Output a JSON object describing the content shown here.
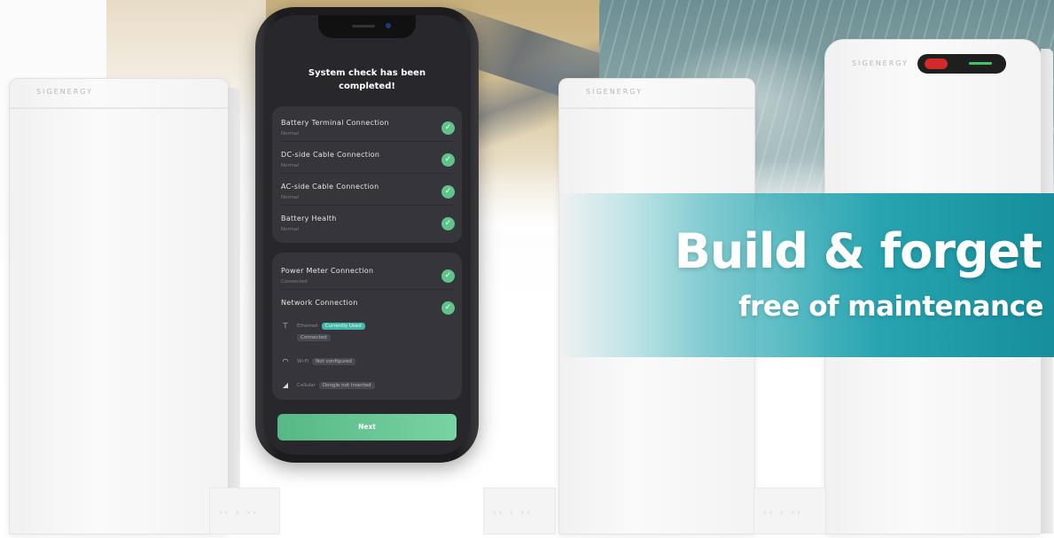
{
  "brand": {
    "name": "SIGENERGY"
  },
  "decor": {
    "chevrons": "‹‹ › ››"
  },
  "phone": {
    "title": "System check has been completed!",
    "group1": [
      {
        "label": "Battery Terminal Connection",
        "status": "Normal"
      },
      {
        "label": "DC-side Cable Connection",
        "status": "Normal"
      },
      {
        "label": "AC-side Cable Connection",
        "status": "Normal"
      },
      {
        "label": "Battery Health",
        "status": "Normal"
      }
    ],
    "group2": {
      "power_meter": {
        "label": "Power Meter Connection",
        "status": "Connected"
      },
      "network": {
        "label": "Network Connection"
      },
      "ethernet": {
        "label": "Ethernet",
        "tag": "Currently Used",
        "status": "Connected"
      },
      "wifi": {
        "label": "Wi-Fi",
        "status": "Not configured"
      },
      "cellular": {
        "label": "Cellular",
        "status": "Dongle not inserted"
      }
    },
    "next_label": "Next",
    "icons": {
      "check": "check-icon",
      "ethernet": "ethernet-icon",
      "wifi": "wifi-icon",
      "cellular": "cellular-icon"
    }
  },
  "banner": {
    "headline": "Build & forget",
    "subline": "free of maintenance"
  },
  "colors": {
    "accent": "#27a4b0",
    "button": "#5fc48a"
  }
}
